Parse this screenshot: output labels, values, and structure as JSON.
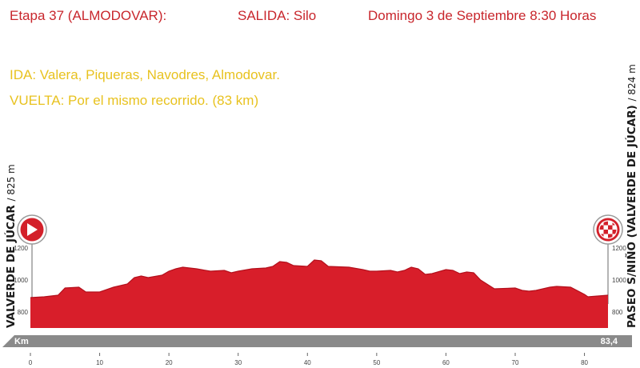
{
  "header": {
    "stage": "Etapa 37  (ALMODOVAR):",
    "start": "SALIDA: Silo",
    "date": "Domingo 3 de Septiembre 8:30 Horas"
  },
  "route": {
    "ida": "IDA: Valera, Piqueras, Navodres, Almodovar.",
    "vuelta": "VUELTA: Por el mismo recorrido. (83 km)"
  },
  "start_point": {
    "name": "VALVERDE DE JÚCAR",
    "altitude": "/ 825 m"
  },
  "finish_point": {
    "name": "PASEO S/NIÑO (VALVERDE DE JÚCAR)",
    "altitude": "/ 824 m"
  },
  "colors": {
    "header": "#c8262c",
    "route": "#e8c21f",
    "profile_fill": "#d81e2a",
    "profile_top": "#b3101c",
    "axis_bar": "#8a8a8a",
    "marker_red": "#d3202a"
  },
  "chart_data": {
    "type": "area",
    "x_unit": "Km",
    "total_label": "83,4",
    "xlim": [
      0,
      83.4
    ],
    "ylim": [
      700,
      1300
    ],
    "x_ticks": [
      0,
      10,
      20,
      30,
      40,
      50,
      60,
      70,
      80
    ],
    "y_ticks": [
      800,
      1000,
      1200
    ],
    "grid": false,
    "series": [
      {
        "x": [
          0,
          2,
          4,
          5,
          7,
          8,
          10,
          12,
          14,
          15,
          16,
          17,
          19,
          20,
          21,
          22,
          24,
          26,
          28,
          29,
          30,
          32,
          34,
          35,
          36,
          37,
          38,
          40,
          41,
          42,
          43,
          46,
          48,
          49,
          50,
          52,
          53,
          54,
          55,
          56,
          57,
          58,
          60,
          61,
          62,
          63,
          64,
          65,
          67,
          70,
          71,
          72,
          73,
          75,
          76,
          78,
          80,
          80.5,
          83.4
        ],
        "y": [
          890,
          895,
          905,
          950,
          955,
          925,
          925,
          955,
          975,
          1015,
          1025,
          1015,
          1030,
          1055,
          1070,
          1080,
          1070,
          1055,
          1060,
          1045,
          1055,
          1070,
          1075,
          1085,
          1115,
          1110,
          1090,
          1085,
          1125,
          1120,
          1085,
          1080,
          1065,
          1055,
          1055,
          1060,
          1050,
          1060,
          1080,
          1070,
          1035,
          1040,
          1065,
          1060,
          1040,
          1050,
          1045,
          1000,
          945,
          950,
          935,
          930,
          935,
          955,
          960,
          955,
          910,
          895,
          905
        ]
      }
    ]
  }
}
